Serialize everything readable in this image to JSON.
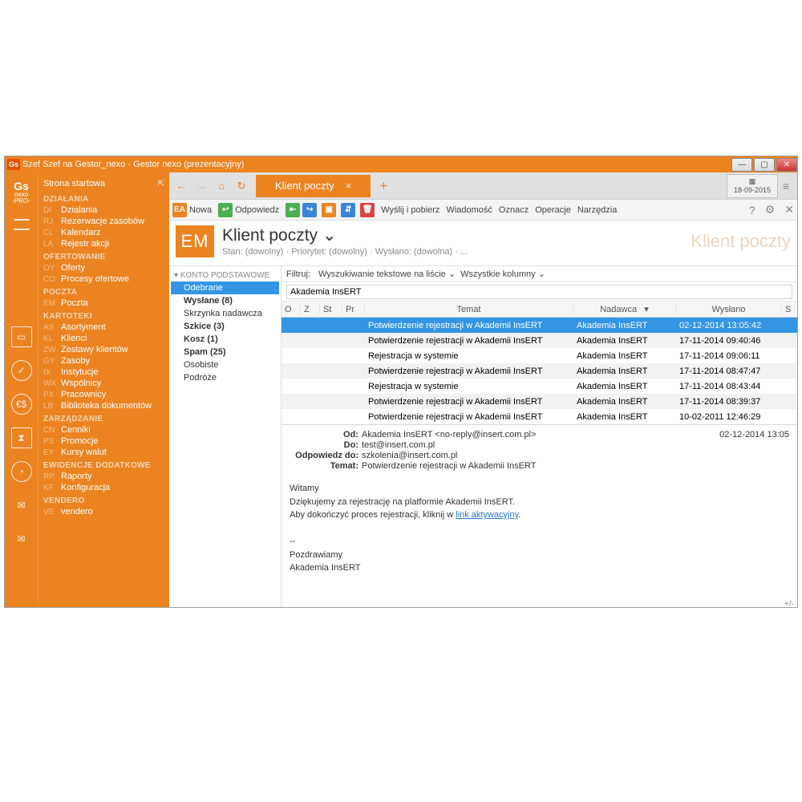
{
  "titlebar": {
    "icon": "Gs",
    "text": "Szef Szef na Gestor_nexo - Gestor nexo (prezentacyjny)"
  },
  "logo": {
    "big": "Gs",
    "sub1": "nexo",
    "sub2": "-PRO-"
  },
  "nav_top": "Strona startowa",
  "nav": [
    {
      "category": "DZIAŁANIA",
      "items": [
        {
          "code": "DI",
          "label": "Działania"
        },
        {
          "code": "RJ",
          "label": "Rezerwacje zasobów"
        },
        {
          "code": "CL",
          "label": "Kalendarz"
        },
        {
          "code": "LA",
          "label": "Rejestr akcji"
        }
      ]
    },
    {
      "category": "OFERTOWANIE",
      "items": [
        {
          "code": "OY",
          "label": "Oferty"
        },
        {
          "code": "CO",
          "label": "Procesy ofertowe"
        }
      ]
    },
    {
      "category": "POCZTA",
      "items": [
        {
          "code": "EM",
          "label": "Poczta"
        }
      ]
    },
    {
      "category": "KARTOTEKI",
      "items": [
        {
          "code": "AS",
          "label": "Asortyment"
        },
        {
          "code": "KL",
          "label": "Klienci"
        },
        {
          "code": "ZW",
          "label": "Zestawy klientów"
        },
        {
          "code": "GY",
          "label": "Zasoby"
        },
        {
          "code": "IX",
          "label": "Instytucje"
        },
        {
          "code": "WX",
          "label": "Wspólnicy"
        },
        {
          "code": "PX",
          "label": "Pracownicy"
        },
        {
          "code": "LB",
          "label": "Biblioteka dokumentów"
        }
      ]
    },
    {
      "category": "ZARZĄDZANIE",
      "items": [
        {
          "code": "CN",
          "label": "Cenniki"
        },
        {
          "code": "PS",
          "label": "Promocje"
        },
        {
          "code": "EY",
          "label": "Kursy walut"
        }
      ]
    },
    {
      "category": "EWIDENCJE DODATKOWE",
      "items": [
        {
          "code": "RP",
          "label": "Raporty"
        },
        {
          "code": "KF",
          "label": "Konfiguracja"
        }
      ]
    },
    {
      "category": "VENDERO",
      "items": [
        {
          "code": "VE",
          "label": "vendero"
        }
      ]
    }
  ],
  "tab": {
    "title": "Klient poczty",
    "date": "18-09-2015"
  },
  "toolbar": {
    "new": "Nowa",
    "reply": "Odpowiedz",
    "send_recv": "Wyślij i pobierz",
    "message": "Wiadomość",
    "mark": "Oznacz",
    "ops": "Operacje",
    "tools": "Narzędzia"
  },
  "header": {
    "badge": "EM",
    "title": "Klient poczty ⌄",
    "crumb": "Stan: (dowolny) · Priorytet: (dowolny) · Wysłano: (dowolna) · ...",
    "ghost": "Klient poczty"
  },
  "folders": {
    "account": "▾ KONTO PODSTAWOWE",
    "items": [
      {
        "label": "Odebrane",
        "sel": true
      },
      {
        "label": "Wysłane (8)",
        "bold": true
      },
      {
        "label": "Skrzynka nadawcza"
      },
      {
        "label": "Szkice (3)",
        "bold": true
      },
      {
        "label": "Kosz (1)",
        "bold": true
      },
      {
        "label": "Spam (25)",
        "bold": true
      },
      {
        "label": "Osobiste"
      },
      {
        "label": "Podróże"
      }
    ]
  },
  "filter": {
    "label": "Filtruj:",
    "opt1": "Wyszukiwanie tekstowe na liście ⌄",
    "opt2": "Wszystkie kolumny ⌄"
  },
  "search": "Akademia InsERT",
  "columns": {
    "o": "O",
    "z": "Z",
    "st": "St",
    "pr": "Pr",
    "temat": "Temat",
    "nadawca": "Nadawca",
    "arrow": "▾",
    "wyslano": "Wysłano",
    "s": "S"
  },
  "rows": [
    {
      "temat": "Potwierdzenie rejestracji w Akademii InsERT",
      "nad": "Akademia InsERT",
      "dt": "02-12-2014 13:05:42",
      "sel": true
    },
    {
      "temat": "Potwierdzenie rejestracji w Akademii InsERT",
      "nad": "Akademia InsERT",
      "dt": "17-11-2014 09:40:46"
    },
    {
      "temat": "Rejestracja w systemie",
      "nad": "Akademia InsERT",
      "dt": "17-11-2014 09:06:11"
    },
    {
      "temat": "Potwierdzenie rejestracji w Akademii InsERT",
      "nad": "Akademia InsERT",
      "dt": "17-11-2014 08:47:47"
    },
    {
      "temat": "Rejestracja w systemie",
      "nad": "Akademia InsERT",
      "dt": "17-11-2014 08:43:44"
    },
    {
      "temat": "Potwierdzenie rejestracji w Akademii InsERT",
      "nad": "Akademia InsERT",
      "dt": "17-11-2014 08:39:37"
    },
    {
      "temat": "Potwierdzenie rejestracji w Akademii InsERT",
      "nad": "Akademia InsERT",
      "dt": "10-02-2011 12:46:29"
    }
  ],
  "preview": {
    "od_k": "Od:",
    "od_v": "Akademia InsERT <no-reply@insert.com.pl>",
    "do_k": "Do:",
    "do_v": "test@insert.com.pl",
    "rep_k": "Odpowiedz do:",
    "rep_v": "szkolenia@insert.com.pl",
    "tm_k": "Temat:",
    "tm_v": "Potwierdzenie rejestracji w Akademii InsERT",
    "date": "02-12-2014 13:05",
    "l1": "Witamy",
    "l2": "Dziękujemy za rejestrację na platformie Akademii InsERT.",
    "l3a": "Aby dokończyć proces rejestracji, kliknij w ",
    "l3b": "link aktywacyjny",
    "l3c": ".",
    "l4": "--",
    "l5": "Pozdrawiamy",
    "l6": "Akademia InsERT",
    "pm": "+/-"
  }
}
